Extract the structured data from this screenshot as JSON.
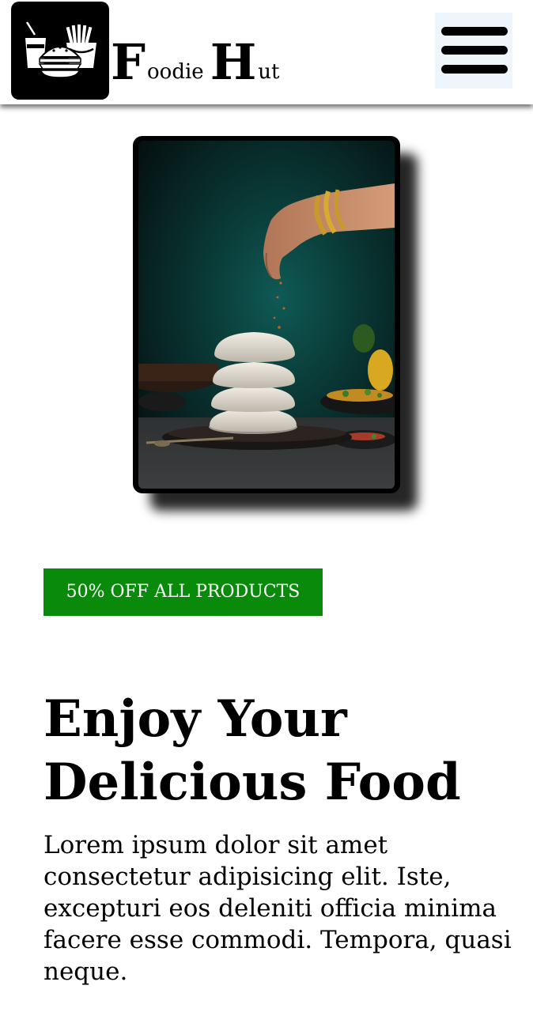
{
  "header": {
    "brand_first_big": "F",
    "brand_first_small": "oodie",
    "brand_second_big": "H",
    "brand_second_small": "ut",
    "logo_icon": "burger-fries-drink-icon",
    "menu_icon": "hamburger-menu-icon"
  },
  "hero": {
    "image_subject": "stacked idli with hand sprinkling spices"
  },
  "promo": {
    "badge": "50% OFF ALL PRODUCTS",
    "badge_color": "#0a8a0a"
  },
  "main": {
    "title_line1": "Enjoy Your",
    "title_line2": "Delicious Food",
    "description": "Lorem ipsum dolor sit amet consectetur adipisicing elit. Iste, excepturi eos deleniti officia minima facere esse commodi. Tempora, quasi neque."
  }
}
